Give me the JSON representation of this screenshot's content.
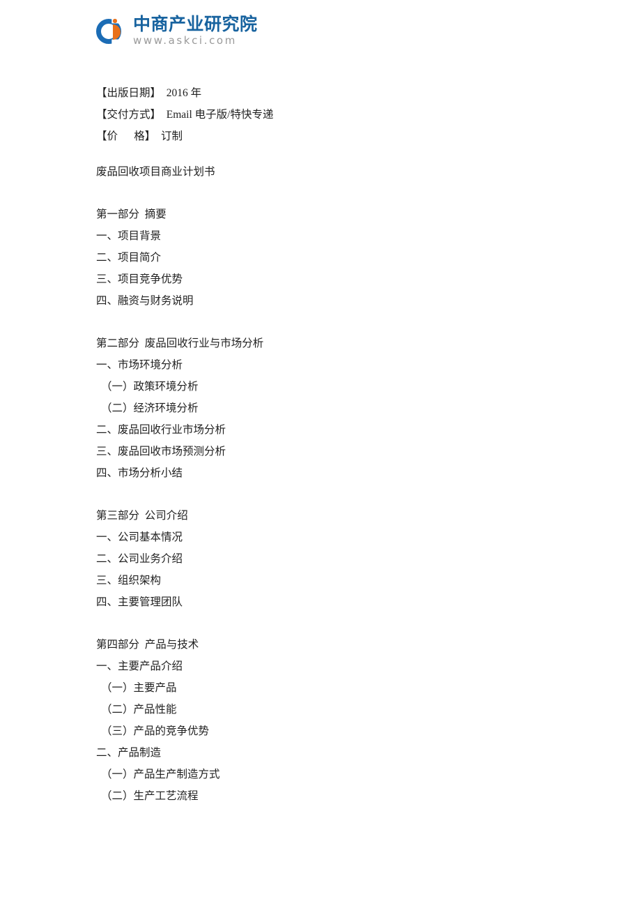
{
  "logo": {
    "name": "中商产业研究院",
    "url": "www.askci.com",
    "brand_blue": "#18639f",
    "brand_orange": "#e8701a",
    "url_gray": "#9a9a9a"
  },
  "meta": [
    {
      "label": "【出版日期】",
      "value": "2016 年"
    },
    {
      "label": "【交付方式】",
      "value": "Email 电子版/特快专递"
    },
    {
      "label": "【价      格】",
      "value": "订制"
    }
  ],
  "title": "废品回收项目商业计划书",
  "sections": [
    {
      "heading": "第一部分  摘要",
      "items": [
        "一、项目背景",
        "二、项目简介",
        "三、项目竞争优势",
        "四、融资与财务说明"
      ]
    },
    {
      "heading": "第二部分  废品回收行业与市场分析",
      "items": [
        "一、市场环境分析",
        "（一）政策环境分析",
        "（二）经济环境分析",
        "二、废品回收行业市场分析",
        "三、废品回收市场预测分析",
        "四、市场分析小结"
      ]
    },
    {
      "heading": "第三部分  公司介绍",
      "items": [
        "一、公司基本情况",
        "二、公司业务介绍",
        "三、组织架构",
        "四、主要管理团队"
      ]
    },
    {
      "heading": "第四部分  产品与技术",
      "items": [
        "一、主要产品介绍",
        "（一）主要产品",
        "（二）产品性能",
        "（三）产品的竞争优势",
        "二、产品制造",
        "（一）产品生产制造方式",
        "（二）生产工艺流程"
      ]
    }
  ]
}
